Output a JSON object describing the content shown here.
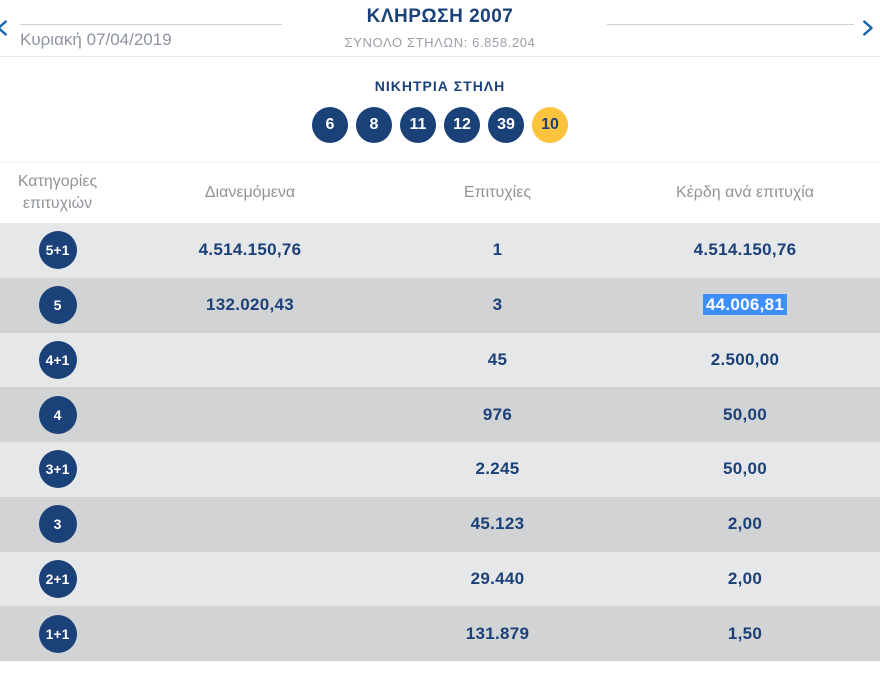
{
  "nav": {
    "date": "Κυριακή 07/04/2019",
    "prev_icon": "chevron-left",
    "next_icon": "chevron-right"
  },
  "header": {
    "title": "ΚΛΗΡΩΣΗ 2007",
    "subtitle": "ΣΥΝΟΛΟ ΣΤΗΛΩΝ: 6.858.204"
  },
  "winning": {
    "title": "ΝΙΚΗΤΡΙΑ ΣΤΗΛΗ",
    "numbers": [
      "6",
      "8",
      "11",
      "12",
      "39"
    ],
    "joker": "10"
  },
  "table": {
    "headers": {
      "categories": "Κατηγορίες επιτυχιών",
      "distributed": "Διανεμόμενα",
      "winners": "Επιτυχίες",
      "prize": "Κέρδη ανά επιτυχία"
    },
    "rows": [
      {
        "category": "5+1",
        "distributed": "4.514.150,76",
        "winners": "1",
        "prize": "4.514.150,76",
        "highlighted": false
      },
      {
        "category": "5",
        "distributed": "132.020,43",
        "winners": "3",
        "prize": "44.006,81",
        "highlighted": true
      },
      {
        "category": "4+1",
        "distributed": "",
        "winners": "45",
        "prize": "2.500,00",
        "highlighted": false
      },
      {
        "category": "4",
        "distributed": "",
        "winners": "976",
        "prize": "50,00",
        "highlighted": false
      },
      {
        "category": "3+1",
        "distributed": "",
        "winners": "2.245",
        "prize": "50,00",
        "highlighted": false
      },
      {
        "category": "3",
        "distributed": "",
        "winners": "45.123",
        "prize": "2,00",
        "highlighted": false
      },
      {
        "category": "2+1",
        "distributed": "",
        "winners": "29.440",
        "prize": "2,00",
        "highlighted": false
      },
      {
        "category": "1+1",
        "distributed": "",
        "winners": "131.879",
        "prize": "1,50",
        "highlighted": false
      }
    ]
  },
  "colors": {
    "navy": "#1b4179",
    "joker_yellow": "#fcc33e",
    "chevron_blue": "#1565ad",
    "header_gray": "#8f9499",
    "date_gray": "#8d94a1",
    "row_light": "#e6e7e9",
    "row_dark": "#d2d3d5",
    "selection_blue": "#3f8efd"
  }
}
